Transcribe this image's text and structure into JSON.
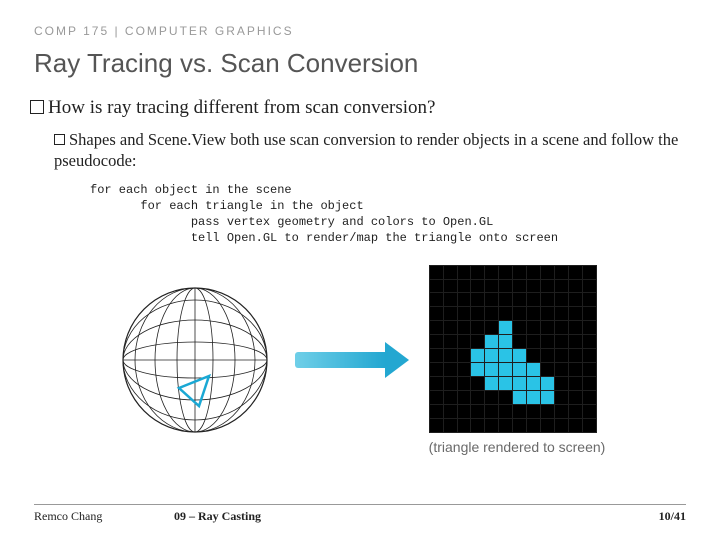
{
  "header": "COMP 175 | COMPUTER GRAPHICS",
  "title": "Ray Tracing vs. Scan Conversion",
  "bullet1": "How is ray tracing different from scan conversion?",
  "bullet2": "Shapes and Scene.View both use scan conversion to render objects in a scene and follow the pseudocode:",
  "code": "for each object in the scene\n       for each triangle in the object\n              pass vertex geometry and colors to Open.GL\n              tell Open.GL to render/map the triangle onto screen",
  "caption": "(triangle rendered to screen)",
  "footer": {
    "author": "Remco Chang",
    "chapter": "09 – Ray Casting",
    "page": "10/41"
  },
  "grid_on": [
    [
      4,
      5
    ],
    [
      5,
      4
    ],
    [
      5,
      5
    ],
    [
      6,
      3
    ],
    [
      6,
      4
    ],
    [
      6,
      5
    ],
    [
      6,
      6
    ],
    [
      7,
      3
    ],
    [
      7,
      4
    ],
    [
      7,
      5
    ],
    [
      7,
      6
    ],
    [
      7,
      7
    ],
    [
      8,
      4
    ],
    [
      8,
      5
    ],
    [
      8,
      6
    ],
    [
      8,
      7
    ],
    [
      8,
      8
    ],
    [
      9,
      6
    ],
    [
      9,
      7
    ],
    [
      9,
      8
    ]
  ]
}
